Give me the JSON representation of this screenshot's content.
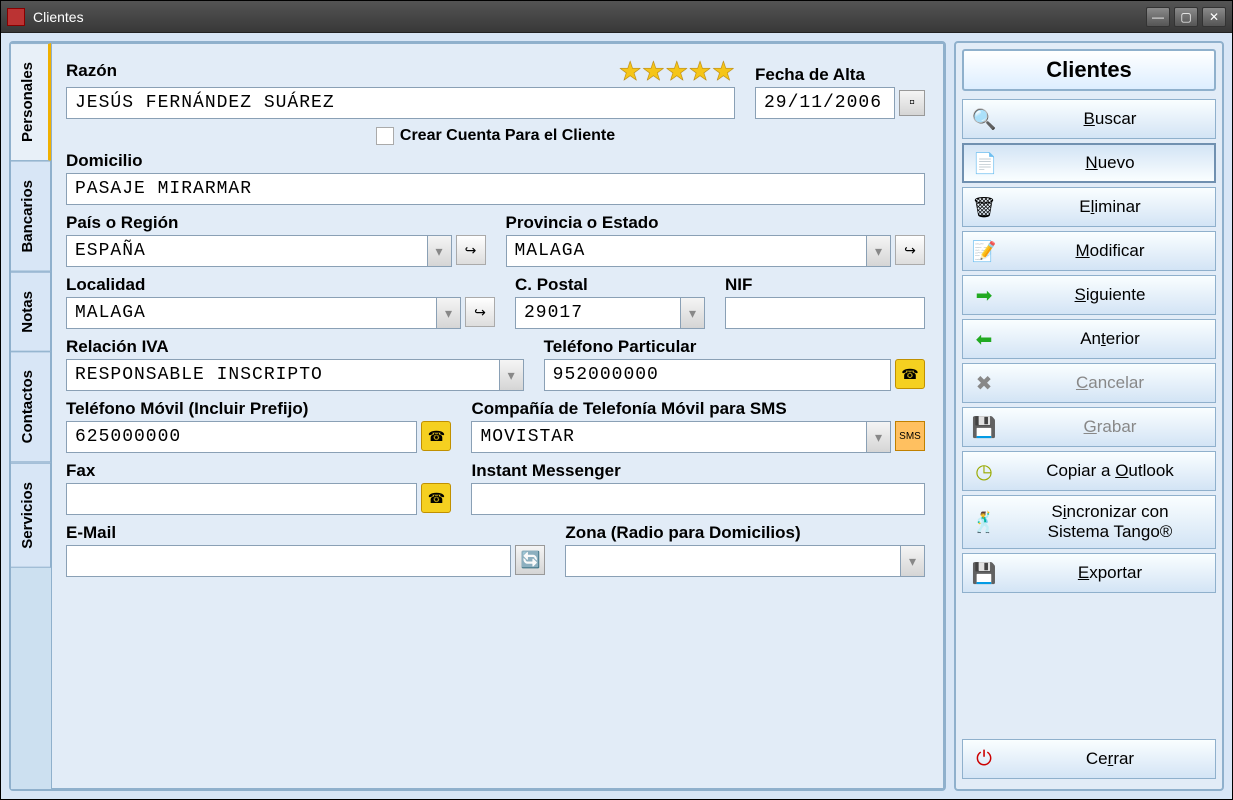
{
  "window": {
    "title": "Clientes"
  },
  "tabs": [
    "Personales",
    "Bancarios",
    "Notas",
    "Contactos",
    "Servicios"
  ],
  "labels": {
    "razon": "Razón",
    "fecha_alta": "Fecha de Alta",
    "crear_cuenta": "Crear Cuenta Para el Cliente",
    "domicilio": "Domicilio",
    "pais": "País o Región",
    "provincia": "Provincia o Estado",
    "localidad": "Localidad",
    "cpostal": "C. Postal",
    "nif": "NIF",
    "relacion_iva": "Relación IVA",
    "tel_particular": "Teléfono Particular",
    "tel_movil": "Teléfono Móvil (Incluir Prefijo)",
    "compania": "Compañía de Telefonía Móvil para SMS",
    "fax": "Fax",
    "instant": "Instant Messenger",
    "email": "E-Mail",
    "zona": "Zona (Radio para Domicilios)"
  },
  "values": {
    "razon": "JESÚS FERNÁNDEZ SUÁREZ",
    "fecha_alta": "29/11/2006",
    "domicilio": "PASAJE MIRARMAR",
    "pais": "ESPAÑA",
    "provincia": "MALAGA",
    "localidad": "MALAGA",
    "cpostal": "29017",
    "nif": "",
    "relacion_iva": "RESPONSABLE INSCRIPTO",
    "tel_particular": "952000000",
    "tel_movil": "625000000",
    "compania": "MOVISTAR",
    "fax": "",
    "instant": "",
    "email": "",
    "zona": ""
  },
  "sidebar": {
    "title": "Clientes",
    "buttons": {
      "buscar": "Buscar",
      "nuevo": "Nuevo",
      "eliminar": "Eliminar",
      "modificar": "Modificar",
      "siguiente": "Siguiente",
      "anterior": "Anterior",
      "cancelar": "Cancelar",
      "grabar": "Grabar",
      "outlook": "Copiar a Outlook",
      "tango": "Sincronizar con Sistema Tango®",
      "exportar": "Exportar",
      "cerrar": "Cerrar"
    }
  }
}
